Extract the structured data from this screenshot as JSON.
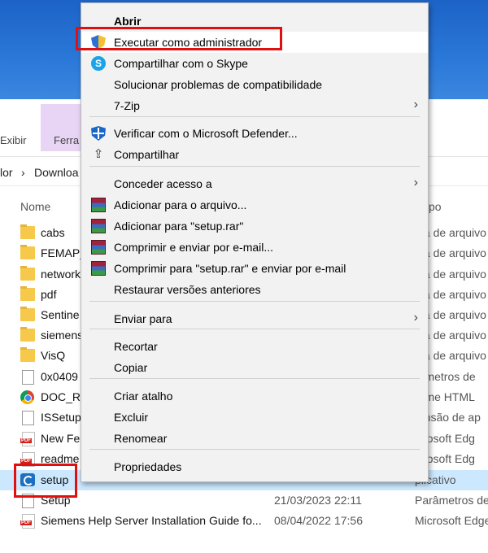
{
  "explorer": {
    "ribbon_tabs": [
      "Exibir",
      "Ferra"
    ],
    "address": {
      "left": "lor",
      "sep": "›",
      "folder": "Downloa"
    },
    "columns": {
      "name": "Nome",
      "type": "po"
    },
    "rows": [
      {
        "name": "cabs",
        "date": "",
        "type": "sta de arquivo",
        "icon": "folder-icon"
      },
      {
        "name": "FEMAP_",
        "date": "",
        "type": "sta de arquivo",
        "icon": "folder-icon"
      },
      {
        "name": "network",
        "date": "",
        "type": "sta de arquivo",
        "icon": "folder-icon"
      },
      {
        "name": "pdf",
        "date": "",
        "type": "sta de arquivo",
        "icon": "folder-icon"
      },
      {
        "name": "Sentine",
        "date": "",
        "type": "sta de arquivo",
        "icon": "folder-icon"
      },
      {
        "name": "siemens",
        "date": "",
        "type": "sta de arquivo",
        "icon": "folder-icon"
      },
      {
        "name": "VisQ",
        "date": "",
        "type": "sta de arquivo",
        "icon": "folder-icon"
      },
      {
        "name": "0x0409",
        "date": "",
        "type": "râmetros de",
        "icon": "settings-file-icon"
      },
      {
        "name": "DOC_RE",
        "date": "",
        "type": "rome HTML",
        "icon": "chrome-icon"
      },
      {
        "name": "ISSetup",
        "date": "",
        "type": "tensão de ap",
        "icon": "file-icon"
      },
      {
        "name": "New Fe",
        "date": "",
        "type": "icrosoft Edg",
        "icon": "pdf-icon"
      },
      {
        "name": "readme",
        "date": "",
        "type": "icrosoft Edg",
        "icon": "pdf-icon"
      },
      {
        "name": "setup",
        "date": "",
        "type": "plicativo",
        "icon": "setup-app-icon",
        "selected": true
      },
      {
        "name": "Setup",
        "date": "21/03/2023 22:11",
        "type": "Parâmetros de",
        "icon": "settings-file-icon"
      },
      {
        "name": "Siemens Help Server Installation Guide fo...",
        "date": "08/04/2022 17:56",
        "type": "Microsoft Edge",
        "icon": "pdf-icon"
      }
    ]
  },
  "context_menu": {
    "items": [
      {
        "label": "Abrir",
        "bold": true
      },
      {
        "label": "Executar como administrador",
        "icon": "uac-shield-icon"
      },
      {
        "label": "Compartilhar com o Skype",
        "icon": "skype-icon"
      },
      {
        "label": "Solucionar problemas de compatibilidade"
      },
      {
        "label": "7-Zip",
        "submenu": true
      },
      {
        "label": "Verificar com o Microsoft Defender...",
        "icon": "defender-icon"
      },
      {
        "label": "Compartilhar",
        "icon": "share-icon"
      },
      {
        "label": "Conceder acesso a",
        "submenu": true
      },
      {
        "label": "Adicionar para o arquivo...",
        "icon": "winrar-icon"
      },
      {
        "label": "Adicionar para \"setup.rar\"",
        "icon": "winrar-icon"
      },
      {
        "label": "Comprimir e enviar por e-mail...",
        "icon": "winrar-icon"
      },
      {
        "label": "Comprimir para \"setup.rar\" e enviar por e-mail",
        "icon": "winrar-icon"
      },
      {
        "label": "Restaurar versões anteriores"
      },
      {
        "label": "Enviar para",
        "submenu": true
      },
      {
        "label": "Recortar"
      },
      {
        "label": "Copiar"
      },
      {
        "label": "Criar atalho"
      },
      {
        "label": "Excluir"
      },
      {
        "label": "Renomear"
      },
      {
        "label": "Propriedades"
      }
    ],
    "submenu_arrow": "›"
  },
  "highlight_color": "#e01010"
}
